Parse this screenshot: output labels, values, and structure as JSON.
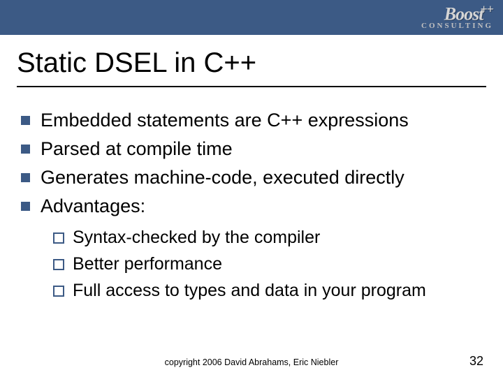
{
  "logo": {
    "main": "Boost",
    "plus": "++",
    "sub": "CONSULTING"
  },
  "title": "Static DSEL in C++",
  "bullets": [
    {
      "text": "Embedded statements are C++ expressions"
    },
    {
      "text": "Parsed at compile time"
    },
    {
      "text": "Generates machine-code, executed directly"
    },
    {
      "text": "Advantages:"
    }
  ],
  "sub_bullets": [
    {
      "text": "Syntax-checked by the compiler"
    },
    {
      "text": "Better performance"
    },
    {
      "text": "Full access to types and data in your program"
    }
  ],
  "footer": "copyright 2006 David Abrahams, Eric Niebler",
  "page": "32"
}
